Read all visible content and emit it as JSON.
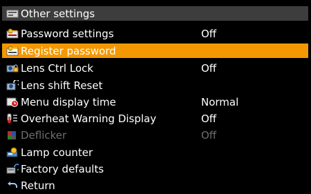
{
  "title": {
    "label": "Other settings",
    "icon": "settings-box-icon"
  },
  "items": [
    {
      "label": "Password settings",
      "value": "Off",
      "icon": "password-key-icon",
      "state": "normal"
    },
    {
      "label": "Register password",
      "value": "",
      "icon": "password-key-icon",
      "state": "selected"
    },
    {
      "label": "Lens Ctrl Lock",
      "value": "Off",
      "icon": "lens-lock-icon",
      "state": "normal"
    },
    {
      "label": "Lens shift Reset",
      "value": "",
      "icon": "lens-reset-icon",
      "state": "normal"
    },
    {
      "label": "Menu display time",
      "value": "Normal",
      "icon": "clock-menu-icon",
      "state": "normal"
    },
    {
      "label": "Overheat Warning Display",
      "value": "Off",
      "icon": "thermometer-icon",
      "state": "normal"
    },
    {
      "label": "Deflicker",
      "value": "Off",
      "icon": "deflicker-icon",
      "state": "disabled"
    },
    {
      "label": "Lamp counter",
      "value": "",
      "icon": "lamp-counter-icon",
      "state": "normal"
    },
    {
      "label": "Factory defaults",
      "value": "",
      "icon": "factory-defaults-icon",
      "state": "normal"
    },
    {
      "label": "Return",
      "value": "",
      "icon": "return-arrow-icon",
      "state": "normal"
    }
  ],
  "colors": {
    "selected": "#f39800",
    "titlebar": "#3d3d3d",
    "disabled": "#6f6f6f"
  }
}
